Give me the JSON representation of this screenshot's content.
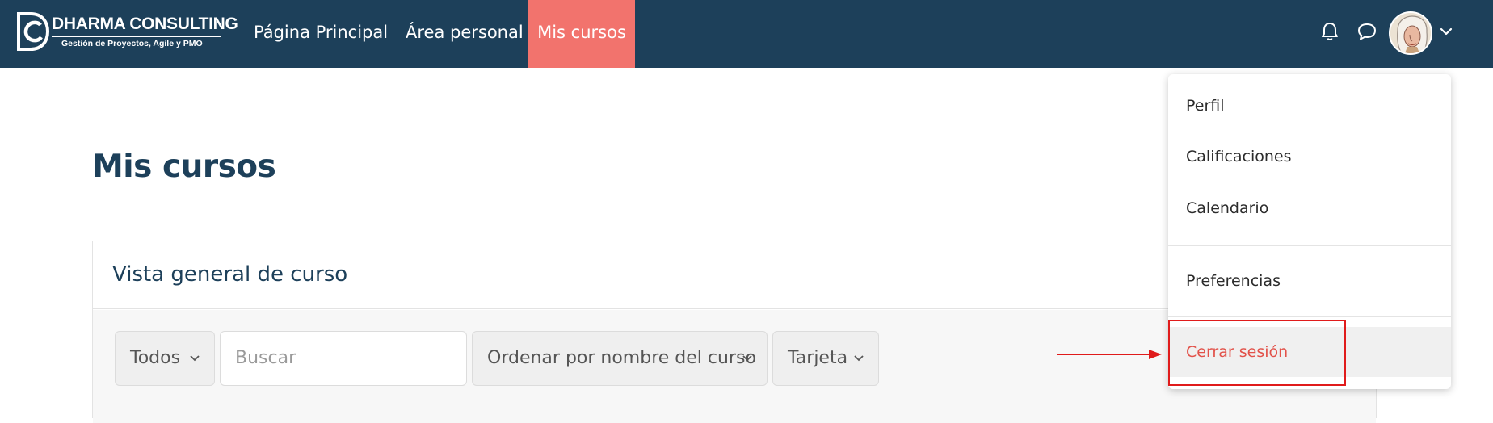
{
  "brand": {
    "title": "DHARMA CONSULTING",
    "subtitle": "Gestión de Proyectos, Agile y PMO",
    "color": "#1d405a"
  },
  "nav": {
    "home": "Página Principal",
    "area": "Área personal",
    "courses": "Mis cursos",
    "active_color": "#f2736d",
    "icons": [
      "bell-icon",
      "chat-icon",
      "avatar",
      "chevron-down-icon"
    ]
  },
  "main": {
    "title": "Mis cursos",
    "card": {
      "title": "Vista general de curso",
      "filter": "Todos",
      "search_placeholder": "Buscar",
      "sort": "Ordenar por nombre del curso",
      "view": "Tarjeta"
    }
  },
  "user_menu": {
    "items": [
      "Perfil",
      "Calificaciones",
      "Calendario",
      "Preferencias"
    ],
    "logout": "Cerrar sesión",
    "logout_color": "#e2524a"
  },
  "annotation": {
    "color": "#e01b1b"
  }
}
